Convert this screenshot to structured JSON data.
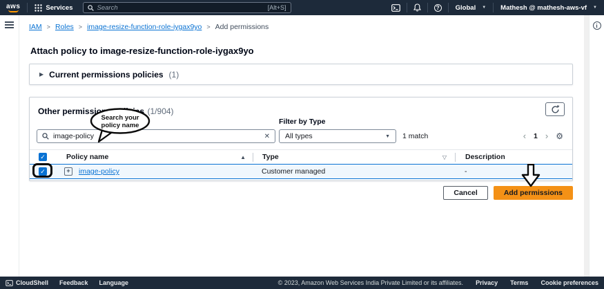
{
  "topnav": {
    "logo": "aws",
    "services_label": "Services",
    "search_placeholder": "Search",
    "search_shortcut": "[Alt+S]",
    "region_label": "Global",
    "account_label": "Mathesh @ mathesh-aws-vf"
  },
  "breadcrumb": {
    "items": [
      {
        "label": "IAM"
      },
      {
        "label": "Roles"
      },
      {
        "label": "image-resize-function-role-iygax9yo"
      },
      {
        "label": "Add permissions"
      }
    ]
  },
  "page": {
    "title": "Attach policy to image-resize-function-role-iygax9yo"
  },
  "current_policies": {
    "title": "Current permissions policies",
    "count": "(1)"
  },
  "other_policies": {
    "title": "Other permissions policies",
    "count": "(1/904)",
    "search_value": "image-policy",
    "filter_label": "Filter by Type",
    "filter_value": "All types",
    "match_text": "1 match",
    "page_number": "1"
  },
  "table": {
    "headers": {
      "policy_name": "Policy name",
      "type": "Type",
      "description": "Description"
    },
    "rows": [
      {
        "name": "image-policy",
        "type": "Customer managed",
        "description": "-"
      }
    ]
  },
  "actions": {
    "cancel": "Cancel",
    "add_permissions": "Add permissions"
  },
  "annotations": {
    "search_tip": "Search your policy name"
  },
  "footer": {
    "cloudshell": "CloudShell",
    "feedback": "Feedback",
    "language": "Language",
    "copyright": "© 2023, Amazon Web Services India Private Limited or its affiliates.",
    "privacy": "Privacy",
    "terms": "Terms",
    "cookie_preferences": "Cookie preferences"
  },
  "icons": {
    "caret_down": "▼",
    "sort_asc": "▲",
    "sort_desc_outline": "▽",
    "check": "✓",
    "expand_plus": "+",
    "gear": "⚙",
    "question": "?",
    "info": "i",
    "prev": "‹",
    "next": "›",
    "clear": "✕",
    "collapsed_arrow": "▶"
  },
  "colors": {
    "nav_dark": "#1d2a3a",
    "accent_orange": "#f49116",
    "link_blue": "#0972d3",
    "selected_row_bg": "#f0f7fd"
  }
}
